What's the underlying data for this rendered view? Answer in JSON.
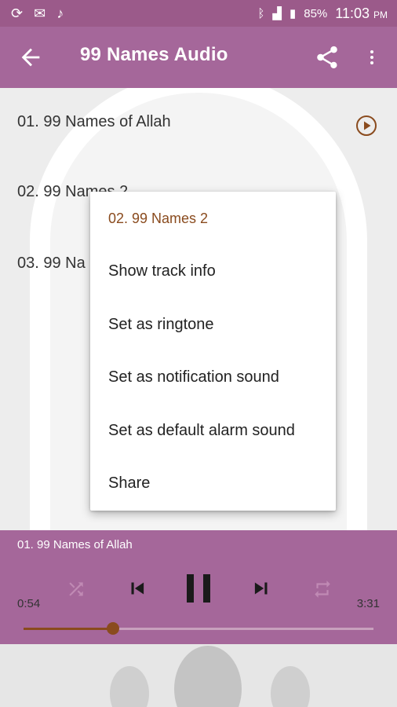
{
  "status_bar": {
    "battery": "85%",
    "time": "11:03",
    "ampm": "PM"
  },
  "app_bar": {
    "title": "99 Names Audio"
  },
  "tracks": [
    {
      "label": "01. 99 Names of Allah"
    },
    {
      "label": "02. 99 Names 2"
    },
    {
      "label": "03. 99 Na"
    }
  ],
  "context_menu": {
    "title": "02. 99 Names 2",
    "items": [
      "Show track info",
      "Set as ringtone",
      "Set as notification sound",
      "Set as default alarm sound",
      "Share"
    ]
  },
  "player": {
    "now_playing": "01. 99 Names of Allah",
    "elapsed": "0:54",
    "total": "3:31",
    "progress": 0.255
  },
  "colors": {
    "primary": "#a5679a",
    "status_bar": "#9b5a8a",
    "accent": "#8a4b1e"
  }
}
